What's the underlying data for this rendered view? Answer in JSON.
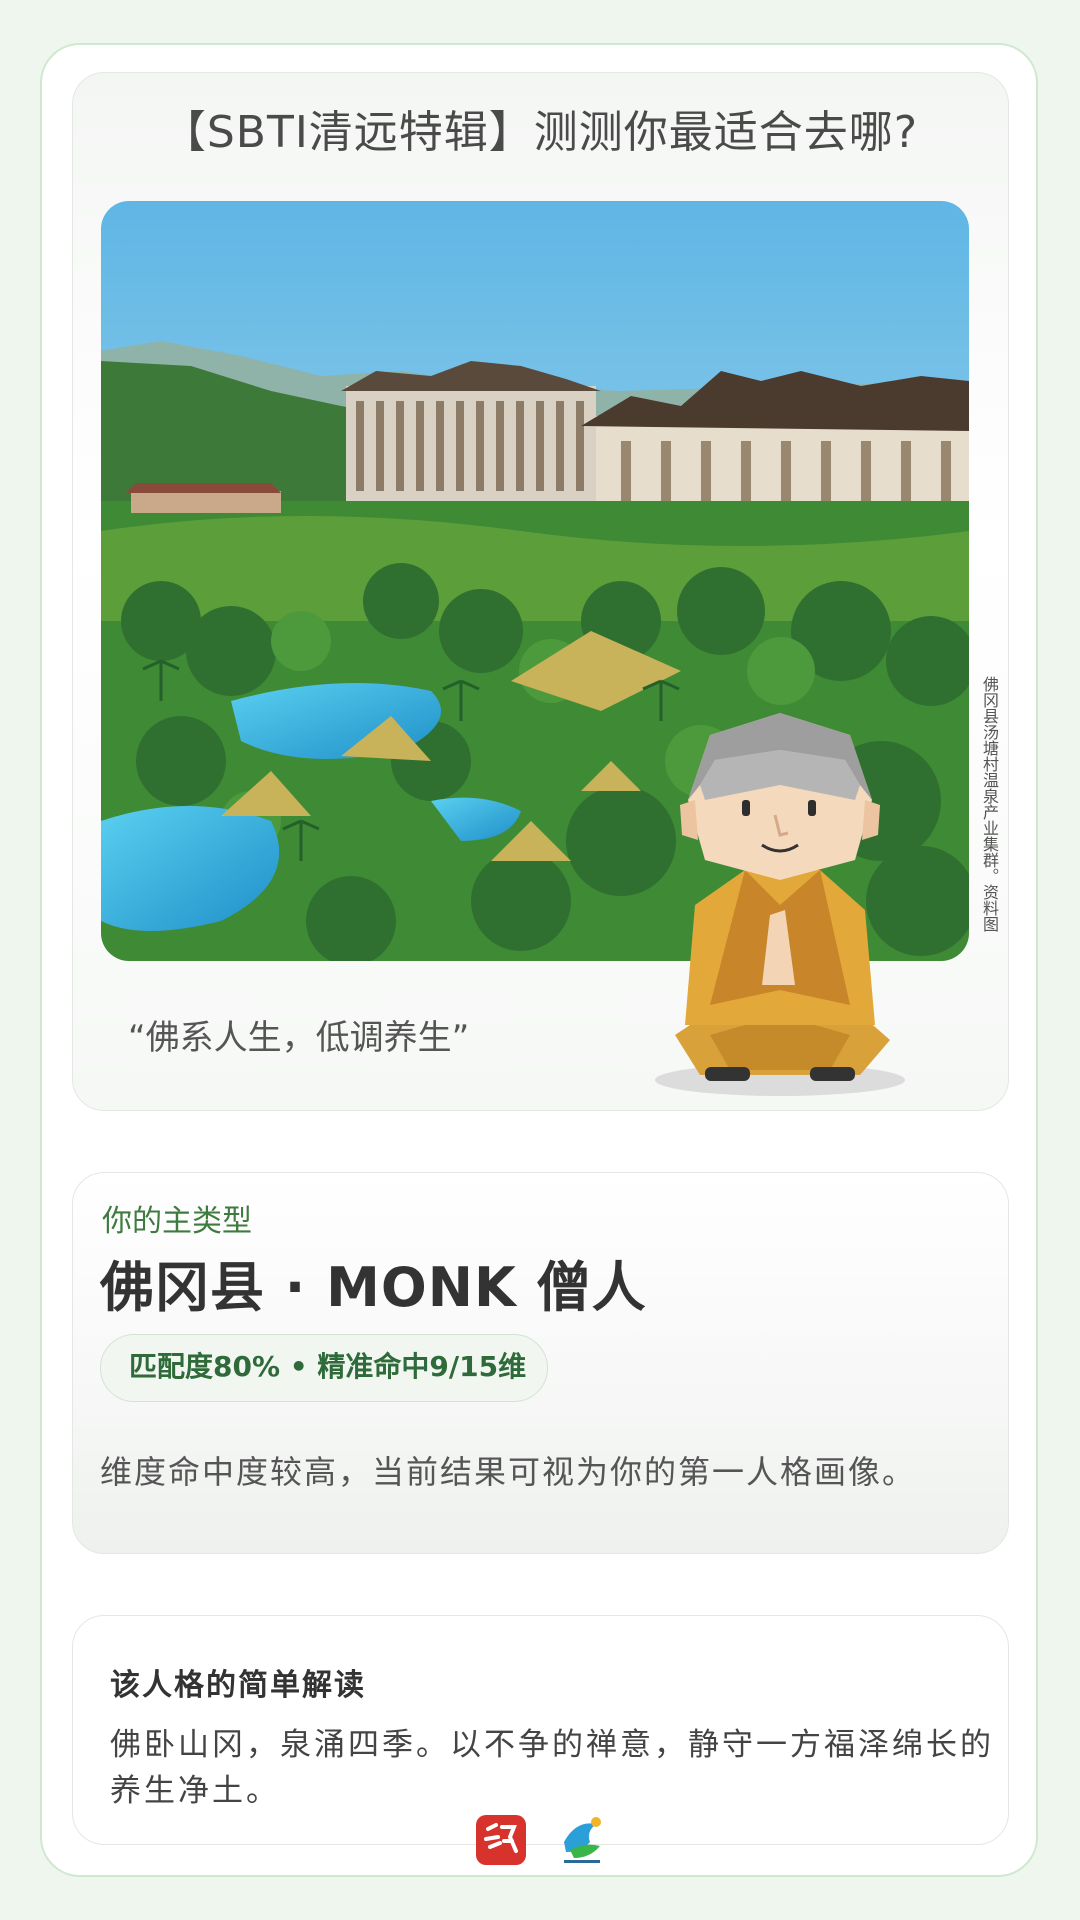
{
  "header": {
    "title": "【SBTI清远特辑】测测你最适合去哪?"
  },
  "hero": {
    "photo_credit": "佛冈县汤塘村温泉产业集群。资料图",
    "quote": "“佛系人生，低调养生”",
    "mascot": "monk-mascot"
  },
  "result": {
    "label": "你的主类型",
    "name": "佛冈县 · MONK 僧人",
    "match": "匹配度80% • 精准命中9/15维",
    "match_percent": 80,
    "hits": 9,
    "dimensions": 15,
    "description": "维度命中度较高，当前结果可视为你的第一人格画像。"
  },
  "interpretation": {
    "title": "该人格的简单解读",
    "text": "佛卧山冈，泉涌四季。以不争的禅意，静守一方福泽绵长的养生净土。"
  },
  "footer": {
    "logos": [
      "xin-qingyuan-logo",
      "culture-qingyuan-logo"
    ]
  },
  "colors": {
    "accent_green": "#3f7a3f",
    "border_green": "#cfe8cf",
    "page_bg": "#eef6ee"
  }
}
